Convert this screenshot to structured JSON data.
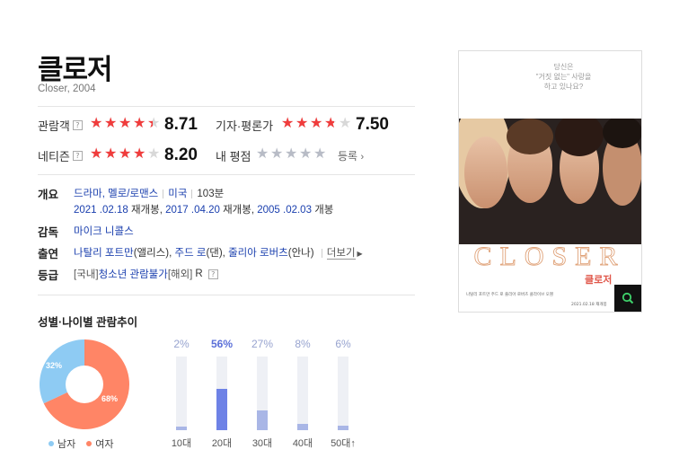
{
  "movie": {
    "title": "클로저",
    "subtitle": "Closer, 2004"
  },
  "ratings": {
    "audience": {
      "label": "관람객",
      "score": "8.71",
      "stars": 4.4
    },
    "critic": {
      "label": "기자·평론가",
      "score": "7.50",
      "stars": 3.75
    },
    "netizen": {
      "label": "네티즌",
      "score": "8.20",
      "stars": 4.1
    },
    "my": {
      "label": "내 평점",
      "register": "등록"
    },
    "help_glyph": "?"
  },
  "info": {
    "overview_key": "개요",
    "genre": "드라마, 멜로/로맨스",
    "country": "미국",
    "runtime": "103분",
    "release_1_date": "2021 .02.18",
    "release_1_note": "재개봉,",
    "release_2_date": "2017 .04.20",
    "release_2_note": "재개봉,",
    "release_3_date": "2005 .02.03",
    "release_3_note": "개봉",
    "director_key": "감독",
    "director": "마이크 니콜스",
    "cast_key": "출연",
    "cast_1": "나탈리 포트만",
    "cast_1_role": "(앨리스),",
    "cast_2": "주드 로",
    "cast_2_role": "(댄),",
    "cast_3": "줄리아 로버츠",
    "cast_3_role": "(안나)",
    "more": "더보기",
    "grade_key": "등급",
    "grade_domestic_prefix": "[국내]",
    "grade_domestic": "청소년 관람불가",
    "grade_foreign_prefix": "[해외]",
    "grade_foreign": "R"
  },
  "poster": {
    "tagline": "당신은\n\"거짓 없는\" 사랑을\n하고 있나요?",
    "big_title": "CLOSER",
    "korean_title": "클로저",
    "cast_line": "나탈리 포트만   주드 로   줄리아 로버츠   클라이브 오웬",
    "date_line": "2021.02.18 재개봉",
    "zoom_icon": "search-icon"
  },
  "stats": {
    "section_title": "성별·나이별 관람추이",
    "gender": [
      {
        "label": "남자",
        "pct": 32,
        "pct_text": "32%",
        "color": "#8ecbf3"
      },
      {
        "label": "여자",
        "pct": 68,
        "pct_text": "68%",
        "color": "#ff8566"
      }
    ],
    "age": [
      {
        "label": "10대",
        "pct": 2,
        "pct_text": "2%",
        "highlight": false
      },
      {
        "label": "20대",
        "pct": 56,
        "pct_text": "56%",
        "highlight": true
      },
      {
        "label": "30대",
        "pct": 27,
        "pct_text": "27%",
        "highlight": false
      },
      {
        "label": "40대",
        "pct": 8,
        "pct_text": "8%",
        "highlight": false
      },
      {
        "label": "50대↑",
        "pct": 6,
        "pct_text": "6%",
        "highlight": false
      }
    ],
    "colors": {
      "highlight": "#6e82e6",
      "normal": "#a9b6e6",
      "track": "#eef0f5"
    }
  }
}
